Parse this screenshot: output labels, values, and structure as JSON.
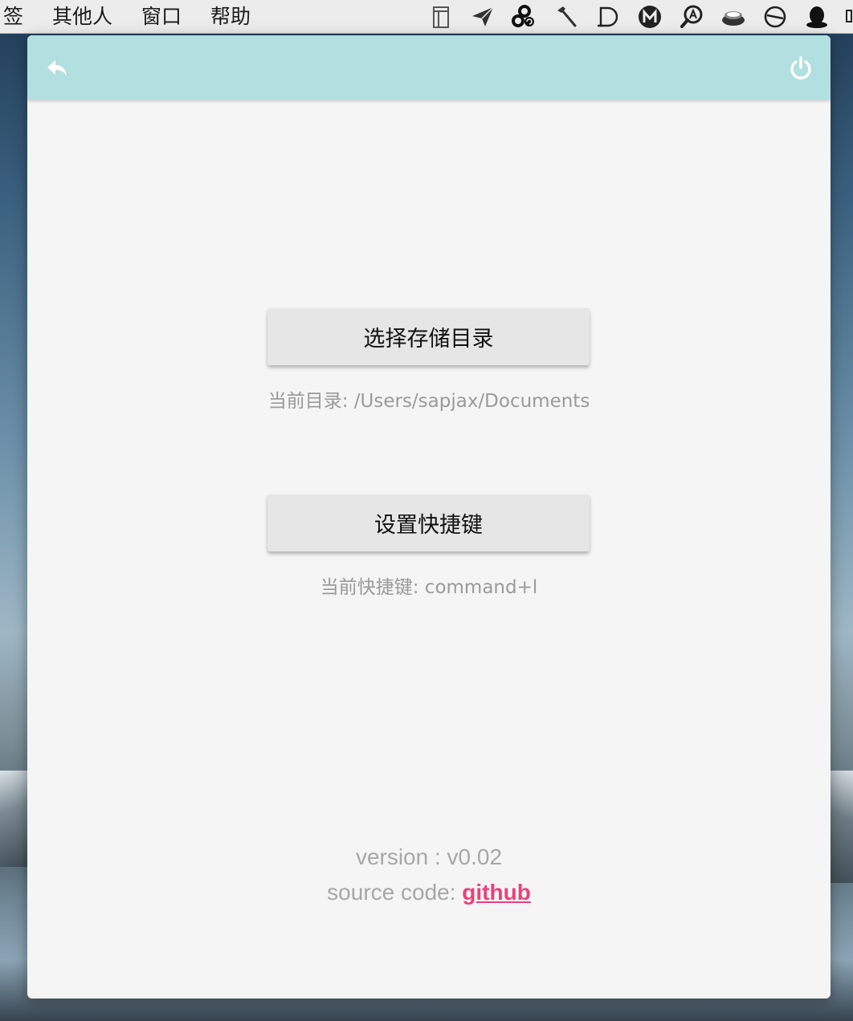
{
  "menubar": {
    "items": [
      "签",
      "其他人",
      "窗口",
      "帮助"
    ],
    "status_icons": [
      "sidebar-panel-icon",
      "paper-plane-icon",
      "cloud-sync-icon",
      "hammer-icon",
      "dash-d-icon",
      "m-circle-icon",
      "search-a-icon",
      "coffee-cup-icon",
      "circle-slash-icon",
      "qq-penguin-icon"
    ]
  },
  "toolbar": {
    "back_icon": "reply-arrow-icon",
    "power_icon": "power-icon",
    "color": "#b2dfdf"
  },
  "directory": {
    "button_label": "选择存储目录",
    "current_label": "当前目录: /Users/sapjax/Documents"
  },
  "hotkey": {
    "button_label": "设置快捷键",
    "current_label": "当前快捷键: command+l"
  },
  "footer": {
    "version_text": "version : v0.02",
    "source_prefix": "source code: ",
    "source_link": "github",
    "link_color": "#ec407a"
  }
}
